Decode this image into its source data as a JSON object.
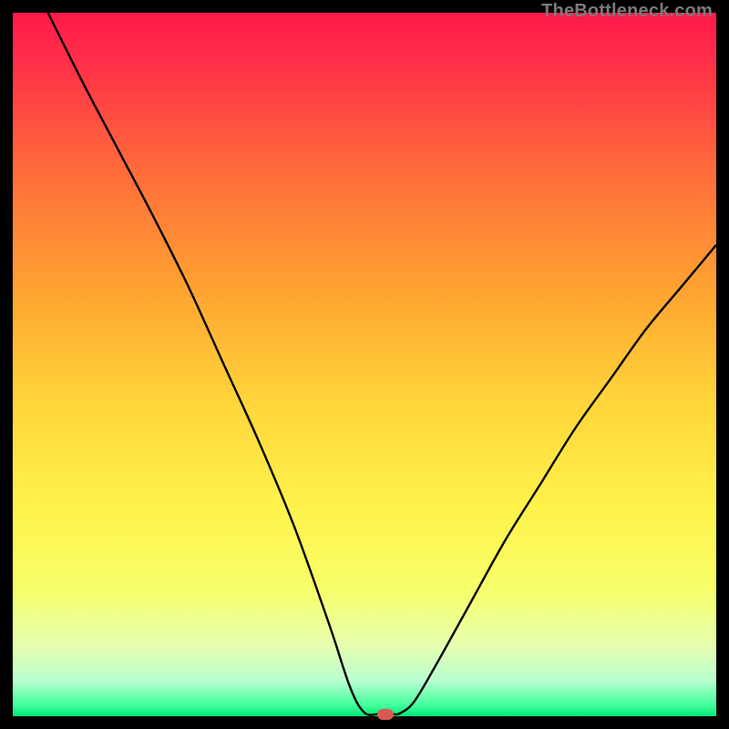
{
  "watermark": {
    "text": "TheBottleneck.com"
  },
  "chart_data": {
    "type": "line",
    "title": "",
    "xlabel": "",
    "ylabel": "",
    "xlim": [
      0,
      100
    ],
    "ylim": [
      0,
      100
    ],
    "gradient": {
      "stops": [
        {
          "pos": 0,
          "color": "#ff1a4b"
        },
        {
          "pos": 0.08,
          "color": "#ff3247"
        },
        {
          "pos": 0.22,
          "color": "#ff6a3a"
        },
        {
          "pos": 0.4,
          "color": "#ffa531"
        },
        {
          "pos": 0.55,
          "color": "#ffd43a"
        },
        {
          "pos": 0.7,
          "color": "#fff24a"
        },
        {
          "pos": 0.82,
          "color": "#f7ff6a"
        },
        {
          "pos": 0.9,
          "color": "#e6ffb0"
        },
        {
          "pos": 0.95,
          "color": "#b8ffd0"
        },
        {
          "pos": 0.985,
          "color": "#40ff9c"
        },
        {
          "pos": 1.0,
          "color": "#00e676"
        }
      ]
    },
    "series": [
      {
        "name": "bottleneck-curve",
        "color": "#000000",
        "width": 2.4,
        "x": [
          5,
          10,
          15,
          20,
          25,
          30,
          35,
          40,
          45,
          48,
          50,
          52,
          54,
          55,
          57,
          60,
          65,
          70,
          75,
          80,
          85,
          90,
          95,
          100
        ],
        "y": [
          100,
          90,
          80.5,
          71,
          61,
          50,
          39,
          27,
          13,
          4,
          0.5,
          0.3,
          0.3,
          0.4,
          2,
          7,
          16,
          25,
          33,
          41,
          48,
          55,
          61,
          67
        ]
      }
    ],
    "marker": {
      "name": "current-point",
      "x": 53,
      "y": 0.3,
      "color": "#d85a53"
    }
  }
}
